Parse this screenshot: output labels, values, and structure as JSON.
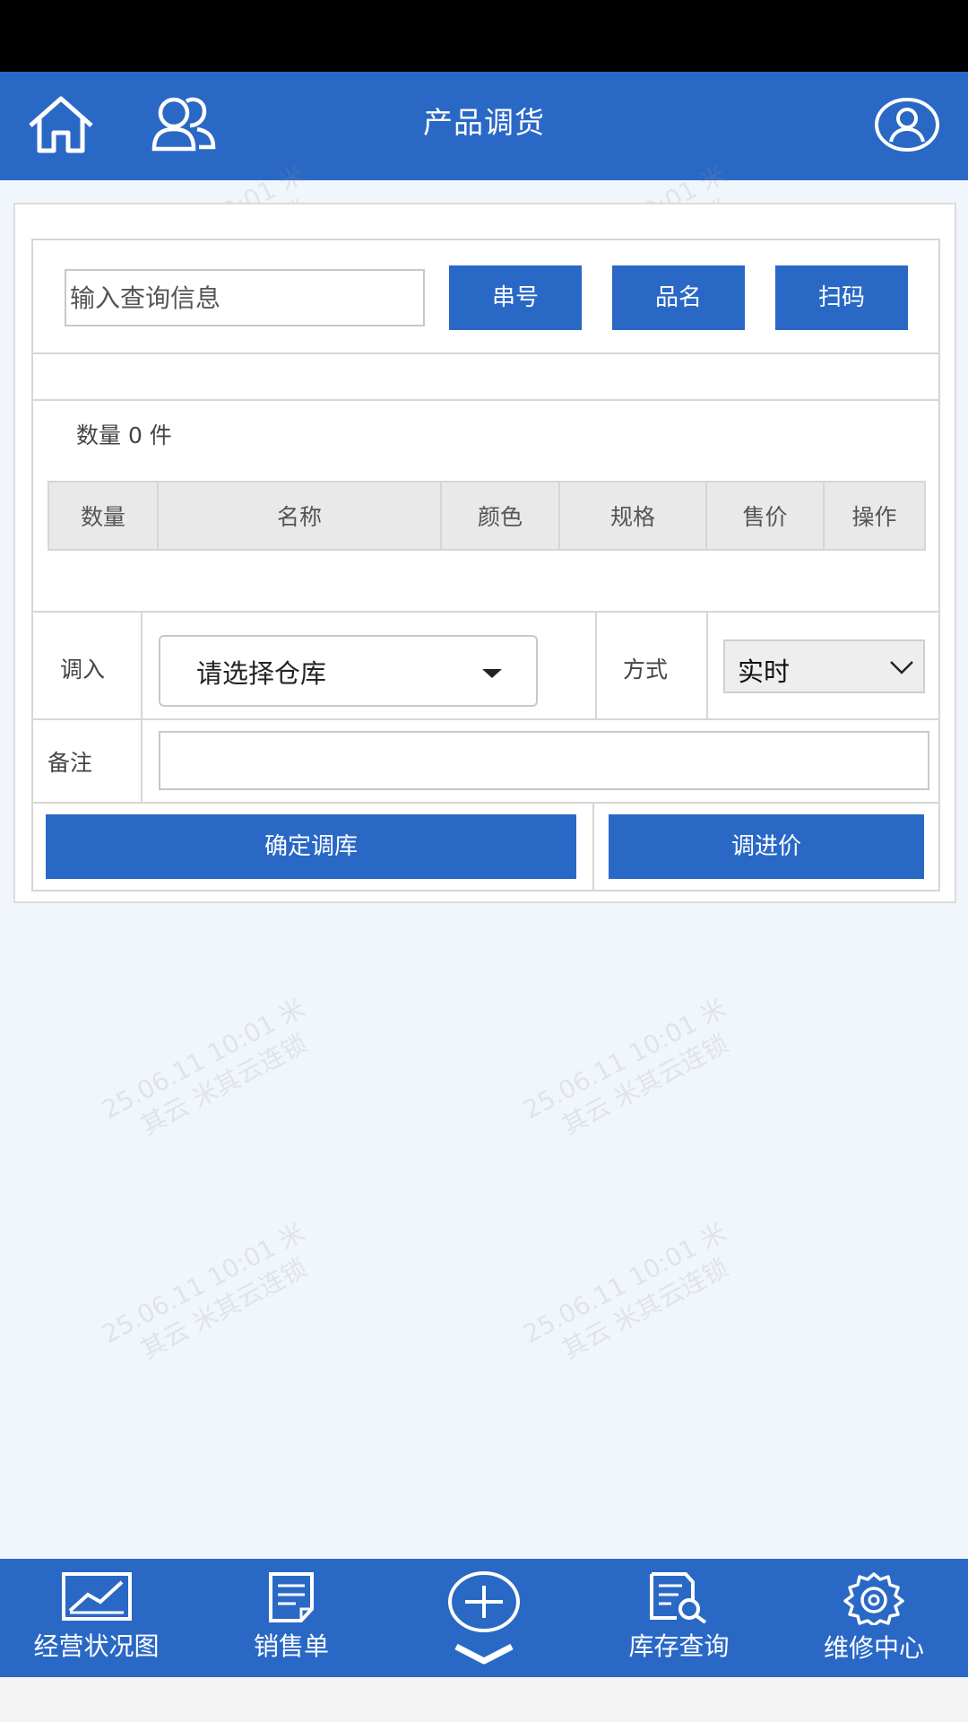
{
  "header": {
    "title": "产品调货"
  },
  "search": {
    "placeholder": "输入查询信息",
    "btn_serial": "串号",
    "btn_name": "品名",
    "btn_scan": "扫码"
  },
  "summary": {
    "quantity_text": "数量 0 件"
  },
  "table": {
    "columns": [
      "数量",
      "名称",
      "颜色",
      "规格",
      "售价",
      "操作"
    ]
  },
  "form": {
    "transfer_in_label": "调入",
    "warehouse_selected": "请选择仓库",
    "mode_label": "方式",
    "mode_selected": "实时",
    "remark_label": "备注",
    "remark_value": ""
  },
  "actions": {
    "confirm_label": "确定调库",
    "adjust_price_label": "调进价"
  },
  "watermark": {
    "line1": "25.06.11 10:01 米",
    "line2": "其云 米其云连锁"
  },
  "bottom_nav": {
    "items": [
      {
        "label": "经营状况图",
        "icon": "chart-icon"
      },
      {
        "label": "销售单",
        "icon": "document-icon"
      },
      {
        "label": "",
        "icon": "plus-circle-icon"
      },
      {
        "label": "库存查询",
        "icon": "inventory-search-icon"
      },
      {
        "label": "维修中心",
        "icon": "gear-icon"
      }
    ]
  },
  "colors": {
    "primary": "#2a68c6",
    "background": "#f1f6fd"
  }
}
